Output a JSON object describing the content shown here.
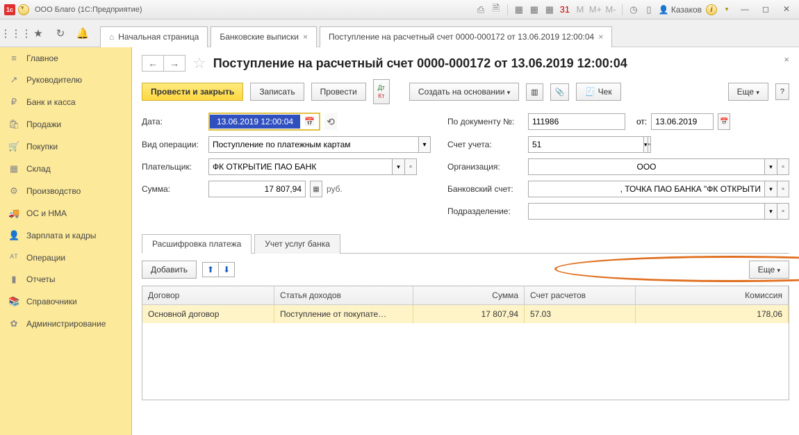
{
  "titlebar": {
    "company": "ООО Благо",
    "app": "(1С:Предприятие)",
    "user": "Казаков"
  },
  "toolbar_tabs": {
    "home": "Начальная страница",
    "bank": "Банковские выписки",
    "receipt": "Поступление на расчетный счет 0000-000172 от 13.06.2019 12:00:04"
  },
  "sidebar": {
    "items": [
      {
        "icon": "≡",
        "label": "Главное"
      },
      {
        "icon": "↗",
        "label": "Руководителю"
      },
      {
        "icon": "₽",
        "label": "Банк и касса"
      },
      {
        "icon": "🛍",
        "label": "Продажи"
      },
      {
        "icon": "🛒",
        "label": "Покупки"
      },
      {
        "icon": "▦",
        "label": "Склад"
      },
      {
        "icon": "⚙",
        "label": "Производство"
      },
      {
        "icon": "🚚",
        "label": "ОС и НМА"
      },
      {
        "icon": "👤",
        "label": "Зарплата и кадры"
      },
      {
        "icon": "ᴬᵀ",
        "label": "Операции"
      },
      {
        "icon": "▮",
        "label": "Отчеты"
      },
      {
        "icon": "📚",
        "label": "Справочники"
      },
      {
        "icon": "✿",
        "label": "Администрирование"
      }
    ]
  },
  "doc": {
    "title": "Поступление на расчетный счет 0000-000172 от 13.06.2019 12:00:04"
  },
  "buttons": {
    "post_close": "Провести и закрыть",
    "save": "Записать",
    "post": "Провести",
    "create_based": "Создать на основании",
    "check": "Чек",
    "more": "Еще"
  },
  "labels": {
    "date": "Дата:",
    "op_type": "Вид операции:",
    "payer": "Плательщик:",
    "sum": "Сумма:",
    "doc_no": "По документу №:",
    "from": "от:",
    "account": "Счет учета:",
    "org": "Организация:",
    "bank_acc": "Банковский счет:",
    "division": "Подразделение:",
    "rub": "руб.",
    "add": "Добавить"
  },
  "values": {
    "date": "13.06.2019 12:00:04",
    "op_type": "Поступление по платежным картам",
    "payer": "ФК ОТКРЫТИЕ ПАО БАНК",
    "sum": "17 807,94",
    "doc_no": "111986",
    "doc_date": "13.06.2019",
    "account": "51",
    "org": "ООО",
    "bank_acc": ", ТОЧКА ПАО БАНКА \"ФК ОТКРЫТИ",
    "division": ""
  },
  "subtabs": {
    "decode": "Расшифровка платежа",
    "bank_serv": "Учет услуг банка"
  },
  "grid": {
    "headers": {
      "contract": "Договор",
      "income": "Статья доходов",
      "sum": "Сумма",
      "account": "Счет расчетов",
      "commission": "Комиссия"
    },
    "row": {
      "contract": "Основной договор",
      "income": "Поступление от покупате…",
      "sum": "17 807,94",
      "account": "57.03",
      "commission": "178,06"
    }
  }
}
